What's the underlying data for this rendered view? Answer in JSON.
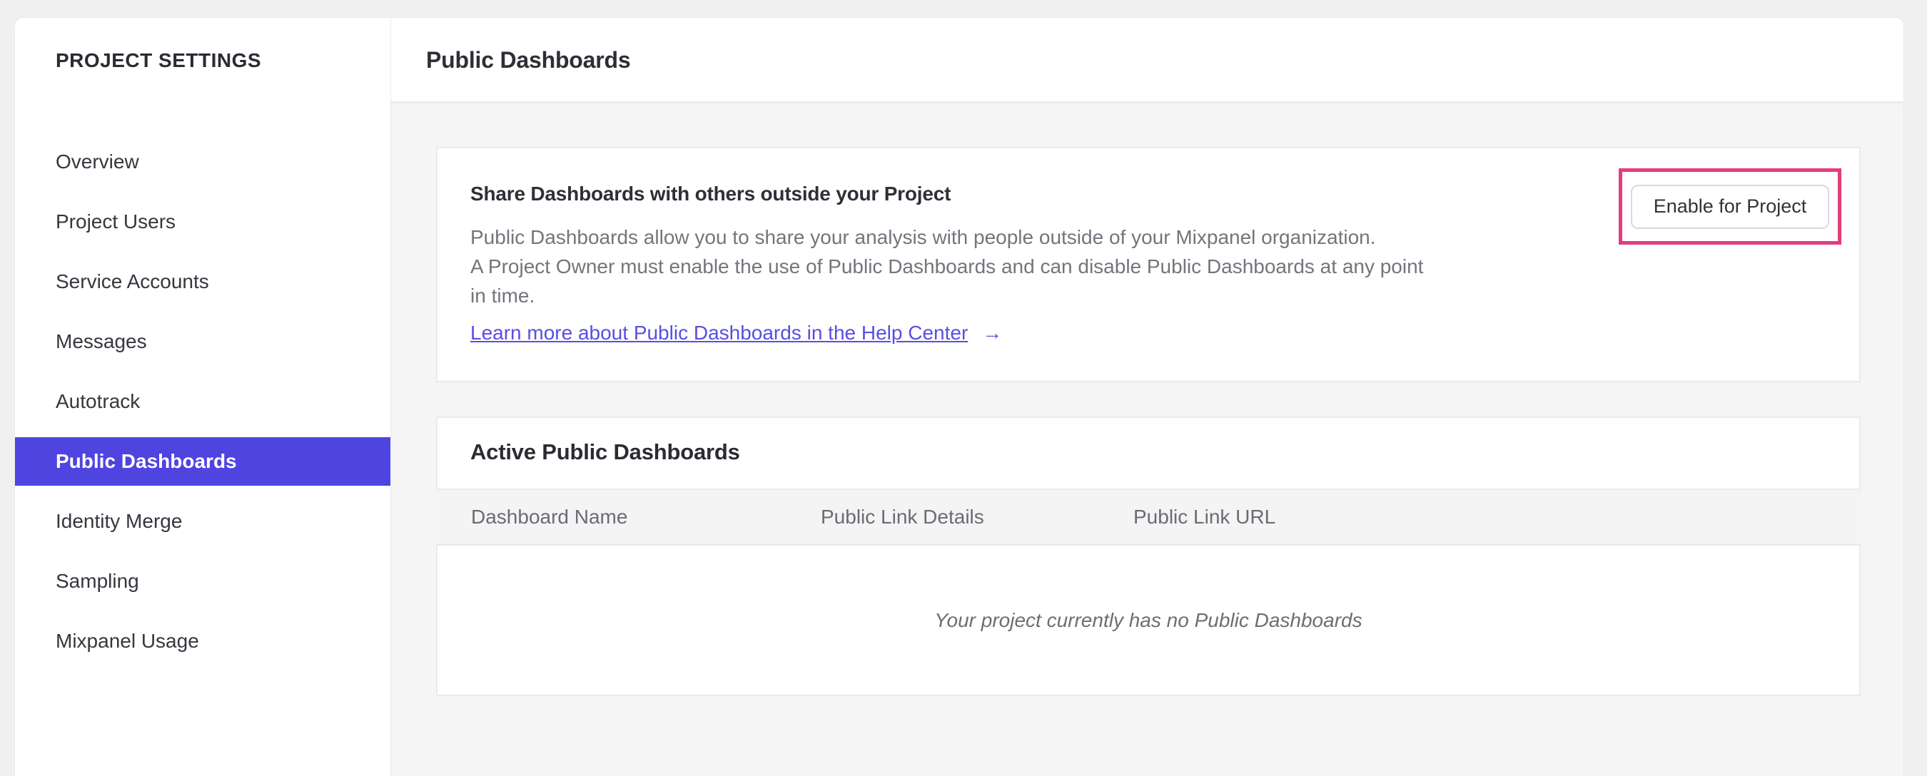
{
  "colors": {
    "accent_purple": "#4f44e0",
    "link_purple": "#5a4ee2",
    "annotation_pink": "#e23c7e",
    "page_background": "#f0f0f1",
    "content_background": "#f5f5f6"
  },
  "sidebar": {
    "title": "PROJECT SETTINGS",
    "items": [
      {
        "label": "Overview",
        "selected": false
      },
      {
        "label": "Project Users",
        "selected": false
      },
      {
        "label": "Service Accounts",
        "selected": false
      },
      {
        "label": "Messages",
        "selected": false
      },
      {
        "label": "Autotrack",
        "selected": false
      },
      {
        "label": "Public Dashboards",
        "selected": true
      },
      {
        "label": "Identity Merge",
        "selected": false
      },
      {
        "label": "Sampling",
        "selected": false
      },
      {
        "label": "Mixpanel Usage",
        "selected": false
      }
    ]
  },
  "header": {
    "title": "Public Dashboards"
  },
  "share_card": {
    "heading": "Share Dashboards with others outside your Project",
    "description_lines": [
      "Public Dashboards allow you to share your analysis with people outside of your Mixpanel organization.",
      "A Project Owner must enable the use of Public Dashboards and can disable Public Dashboards at any point",
      "in time."
    ],
    "link_label": "Learn more about Public Dashboards in the Help Center",
    "arrow_icon": "→",
    "button_label": "Enable for Project"
  },
  "active_card": {
    "heading": "Active Public Dashboards",
    "columns": [
      "Dashboard Name",
      "Public Link Details",
      "Public Link URL"
    ],
    "empty_message": "Your project currently has no Public Dashboards"
  }
}
